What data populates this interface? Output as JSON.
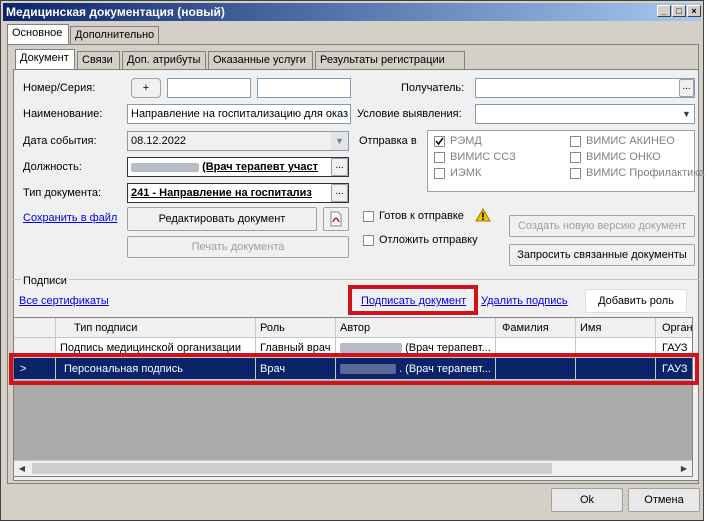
{
  "window": {
    "title": "Медицинская документация (новый)",
    "min_icon": "minimize-icon",
    "max_icon": "maximize-icon",
    "close_icon": "close-icon"
  },
  "top_tabs": [
    {
      "label": "Основное",
      "active": true
    },
    {
      "label": "Дополнительно",
      "active": false
    }
  ],
  "sub_tabs": [
    {
      "label": "Документ",
      "active": true
    },
    {
      "label": "Связи",
      "active": false
    },
    {
      "label": "Доп. атрибуты",
      "active": false
    },
    {
      "label": "Оказанные услуги",
      "active": false
    },
    {
      "label": "Результаты регистрации",
      "active": false
    }
  ],
  "form": {
    "number_label": "Номер/Серия:",
    "plus_label": "+",
    "number_value": "",
    "series_value": "",
    "name_label": "Наименование:",
    "name_value": "Направление на госпитализацию для оказ",
    "date_label": "Дата события:",
    "date_value": "08.12.2022",
    "position_label": "Должность:",
    "position_value": "(Врач терапевт участ",
    "doctype_label": "Тип документа:",
    "doctype_value": "241 - Направление на госпитализ",
    "save_file_link": "Сохранить в файл",
    "edit_doc_btn": "Редактировать документ",
    "print_doc_btn": "Печать документа",
    "receiver_label": "Получатель:",
    "receiver_value": "",
    "condition_label": "Условие выявления:",
    "condition_value": "",
    "send_to_label": "Отправка в",
    "send_targets": [
      {
        "label": "РЭМД",
        "checked": true
      },
      {
        "label": "ВИМИС АКИНЕО",
        "checked": false
      },
      {
        "label": "ВИМИС ССЗ",
        "checked": false
      },
      {
        "label": "ВИМИС ОНКО",
        "checked": false
      },
      {
        "label": "ИЭМК",
        "checked": false
      },
      {
        "label": "ВИМИС Профилактика",
        "checked": false
      }
    ],
    "ready_label": "Готов к отправке",
    "postpone_label": "Отложить отправку",
    "new_version_btn": "Создать новую версию документ",
    "request_linked_btn": "Запросить связанные документы"
  },
  "signatures": {
    "group_label": "Подписи",
    "all_certs_link": "Все сертификаты",
    "sign_link": "Подписать документ",
    "delete_sign_link": "Удалить подпись",
    "add_role_btn": "Добавить роль",
    "columns": [
      "Тип подписи",
      "Роль",
      "Автор",
      "Фамилия",
      "Имя",
      "Орган"
    ],
    "rows": [
      {
        "type": "Подпись медицинской организации",
        "role": "Главный врач",
        "author": "(Врач терапевт...",
        "surname": "",
        "name": "",
        "org": "ГАУЗ",
        "selected": false
      },
      {
        "type": "Персональная подпись",
        "role": "Врач",
        "author": ". (Врач терапевт...",
        "surname": "",
        "name": "",
        "org": "ГАУЗ",
        "selected": true
      }
    ]
  },
  "footer": {
    "ok_btn": "Ok",
    "cancel_btn": "Отмена"
  },
  "colors": {
    "title_start": "#0a246a",
    "title_end": "#a6caf0",
    "selection": "#0a246a",
    "highlight_frame": "#d0121b",
    "link": "#0000ee"
  }
}
